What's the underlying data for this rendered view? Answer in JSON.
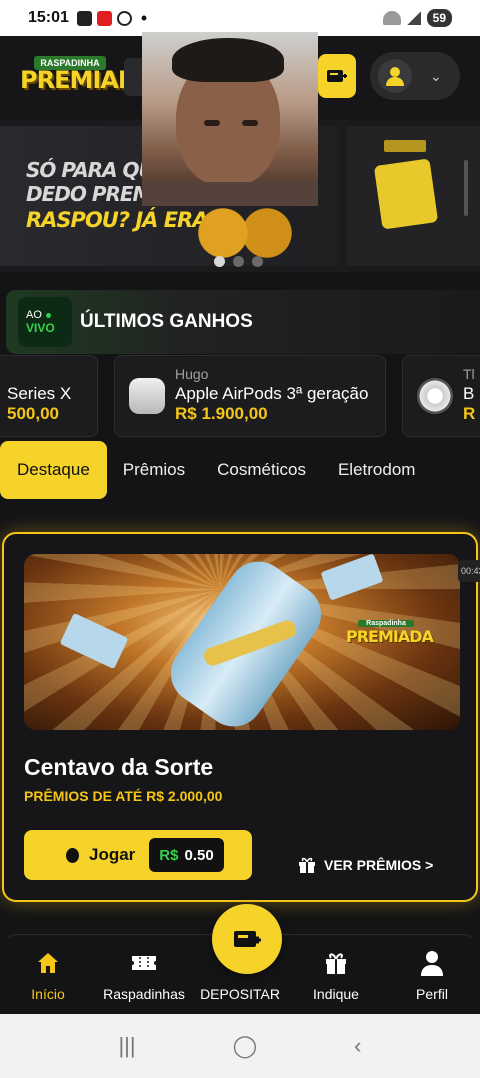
{
  "status_bar": {
    "time": "15:01",
    "battery": "59"
  },
  "header": {
    "logo_top": "RASPADINHA",
    "logo_main": "PREMIADA"
  },
  "banner": {
    "line1": "SÓ PARA QUEM TE",
    "line2": "DEDO PREMIAD",
    "line3": "RASPOU? JÁ ERA!",
    "slides": 3,
    "active_slide": 1
  },
  "live_wins": {
    "badge_top": "AO",
    "badge_bottom": "VIVO",
    "title": "ÚLTIMOS GANHOS",
    "items": [
      {
        "user": "",
        "product": "Series X",
        "value": "500,00"
      },
      {
        "user": "Hugo",
        "product": "Apple AirPods 3ª geração",
        "value": "R$ 1.900,00"
      },
      {
        "user": "Tl",
        "product": "B",
        "value": "R"
      }
    ]
  },
  "tabs": [
    {
      "label": "Destaque",
      "active": true
    },
    {
      "label": "Prêmios",
      "active": false
    },
    {
      "label": "Cosméticos",
      "active": false
    },
    {
      "label": "Eletrodom",
      "active": false
    }
  ],
  "game_card": {
    "image_logo_top": "Raspadinha",
    "image_logo_main": "PREMIADA",
    "timer": "00:43",
    "name": "Centavo da Sorte",
    "subtitle": "PRÊMIOS DE ATÉ R$ 2.000,00",
    "play_label": "Jogar",
    "price_currency": "R$",
    "price_amount": "0.50",
    "prizes_link": "VER PRÊMIOS >"
  },
  "bottom_nav": {
    "items": [
      {
        "label": "Início",
        "icon": "home-icon",
        "active": true
      },
      {
        "label": "Raspadinhas",
        "icon": "ticket-icon",
        "active": false
      },
      {
        "label": "DEPOSITAR",
        "icon": "deposit-icon",
        "active": false
      },
      {
        "label": "Indique",
        "icon": "gift-icon",
        "active": false
      },
      {
        "label": "Perfil",
        "icon": "user-icon",
        "active": false
      }
    ]
  },
  "colors": {
    "accent": "#f5d328",
    "live_green": "#38d04a",
    "background": "#141416"
  }
}
